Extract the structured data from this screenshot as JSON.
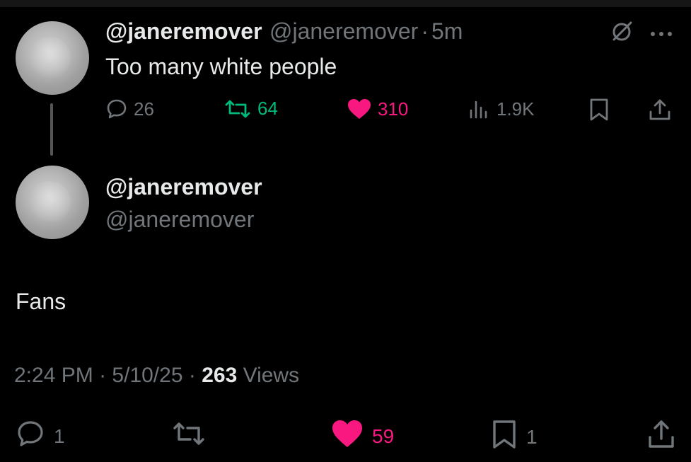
{
  "quoted_tweet": {
    "display_name": "@janeremover",
    "handle": "@janeremover",
    "separator": "·",
    "time_ago": "5m",
    "text": "Too many white people",
    "stats": {
      "replies": "26",
      "reposts": "64",
      "likes": "310",
      "views": "1.9K"
    }
  },
  "reply_tweet": {
    "display_name": "@janeremover",
    "handle": "@janeremover",
    "text": "Fans",
    "time": "2:24 PM",
    "sep1": "·",
    "date": "5/10/25",
    "sep2": "·",
    "views_count": "263",
    "views_label": "Views",
    "stats": {
      "replies": "1",
      "likes": "59",
      "bookmarks": "1"
    }
  },
  "colors": {
    "repost_green": "#00ba7c",
    "like_pink": "#f91880",
    "muted": "#71767b",
    "text": "#e7e9ea",
    "background": "#000000"
  },
  "icons": {
    "reply": "speech-bubble-icon",
    "repost": "repost-arrows-icon",
    "like": "heart-icon",
    "views": "bar-chart-icon",
    "bookmark": "bookmark-icon",
    "share": "share-upload-icon",
    "grok": "grok-slash-circle-icon",
    "more": "more-dots-icon"
  }
}
